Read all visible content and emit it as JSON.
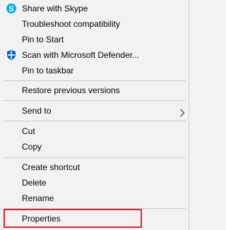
{
  "menu": {
    "share_skype": "Share with Skype",
    "troubleshoot": "Troubleshoot compatibility",
    "pin_start": "Pin to Start",
    "scan_defender": "Scan with Microsoft Defender...",
    "pin_taskbar": "Pin to taskbar",
    "restore_versions": "Restore previous versions",
    "send_to": "Send to",
    "cut": "Cut",
    "copy": "Copy",
    "create_shortcut": "Create shortcut",
    "delete": "Delete",
    "rename": "Rename",
    "properties": "Properties"
  },
  "icons": {
    "skype": "skype-icon",
    "defender": "defender-shield-icon",
    "submenu": "chevron-right-icon"
  },
  "colors": {
    "menu_background": "#f2f2f2",
    "separator": "#cccccc",
    "skype_blue": "#00aff0",
    "defender_blue": "#0067c0",
    "highlight_red": "#e0242e"
  },
  "highlighted_item": "Properties"
}
